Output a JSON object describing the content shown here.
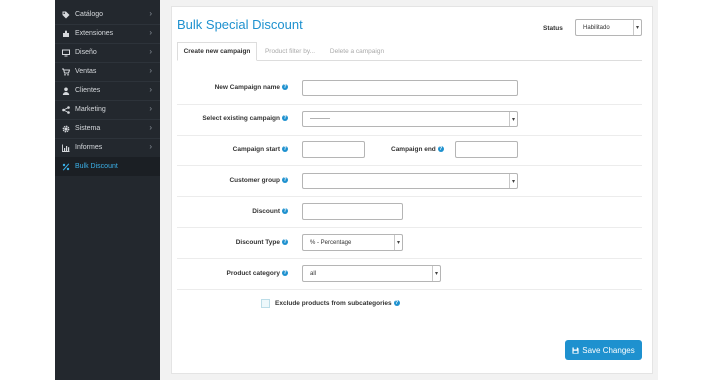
{
  "sidebar": {
    "items": [
      {
        "label": "Catálogo",
        "icon": "tag-icon",
        "chevron": "›"
      },
      {
        "label": "Extensiones",
        "icon": "puzzle-icon",
        "chevron": "›"
      },
      {
        "label": "Diseño",
        "icon": "monitor-icon",
        "chevron": "›"
      },
      {
        "label": "Ventas",
        "icon": "cart-icon",
        "chevron": "›"
      },
      {
        "label": "Clientes",
        "icon": "user-icon",
        "chevron": "›"
      },
      {
        "label": "Marketing",
        "icon": "share-icon",
        "chevron": "›"
      },
      {
        "label": "Sistema",
        "icon": "gear-icon",
        "chevron": "›"
      },
      {
        "label": "Informes",
        "icon": "bar-chart-icon",
        "chevron": "›"
      },
      {
        "label": "Bulk Discount",
        "icon": "percent-icon",
        "chevron": ""
      }
    ],
    "active_color": "#3bb0e8"
  },
  "header": {
    "title": "Bulk Special Discount",
    "status_label": "Status",
    "status_value": "Habilitado"
  },
  "tabs": [
    {
      "label": "Create new campaign",
      "active": true
    },
    {
      "label": "Product filter by...",
      "active": false
    },
    {
      "label": "Delete a campaign",
      "active": false
    }
  ],
  "form": {
    "campaign_name_label": "New Campaign name",
    "campaign_name_value": "",
    "existing_campaign_label": "Select existing campaign",
    "existing_campaign_value": "----------",
    "campaign_start_label": "Campaign start",
    "campaign_start_value": "",
    "campaign_end_label": "Campaign end",
    "campaign_end_value": "",
    "customer_group_label": "Customer group",
    "customer_group_value": "",
    "discount_label": "Discount",
    "discount_value": "",
    "discount_type_label": "Discount Type",
    "discount_type_value": "% - Percentage",
    "product_category_label": "Product category",
    "product_category_value": "all",
    "exclude_label": "Exclude products from subcategories",
    "exclude_checked": false,
    "help_glyph": "?"
  },
  "actions": {
    "save_label": "Save Changes"
  },
  "colors": {
    "accent": "#1e91cf",
    "sidebar_bg": "#23282e"
  }
}
